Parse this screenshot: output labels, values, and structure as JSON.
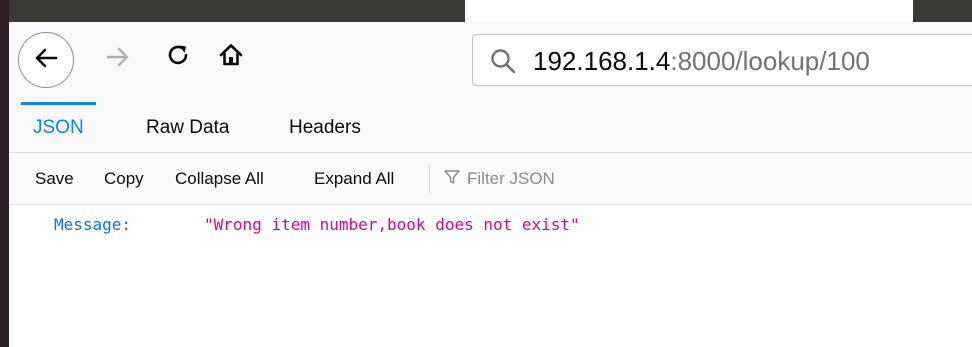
{
  "browser": {
    "url_host": "192.168.1.4",
    "url_rest": ":8000/lookup/100",
    "icons": {
      "back": "back-arrow-icon",
      "forward": "forward-arrow-icon",
      "reload": "reload-icon",
      "home": "home-icon",
      "search": "search-icon",
      "filter": "filter-icon"
    }
  },
  "viewer": {
    "tabs": [
      {
        "label": "JSON",
        "active": true
      },
      {
        "label": "Raw Data",
        "active": false
      },
      {
        "label": "Headers",
        "active": false
      }
    ],
    "actions": {
      "save": "Save",
      "copy": "Copy",
      "collapse_all": "Collapse All",
      "expand_all": "Expand All"
    },
    "filter_placeholder": "Filter JSON"
  },
  "json": {
    "rows": [
      {
        "key": "Message:",
        "value": "\"Wrong item number,book does not exist\""
      }
    ]
  },
  "colors": {
    "accent": "#0a84ff",
    "json_key": "#0074e8",
    "json_string": "#dd00a9"
  }
}
